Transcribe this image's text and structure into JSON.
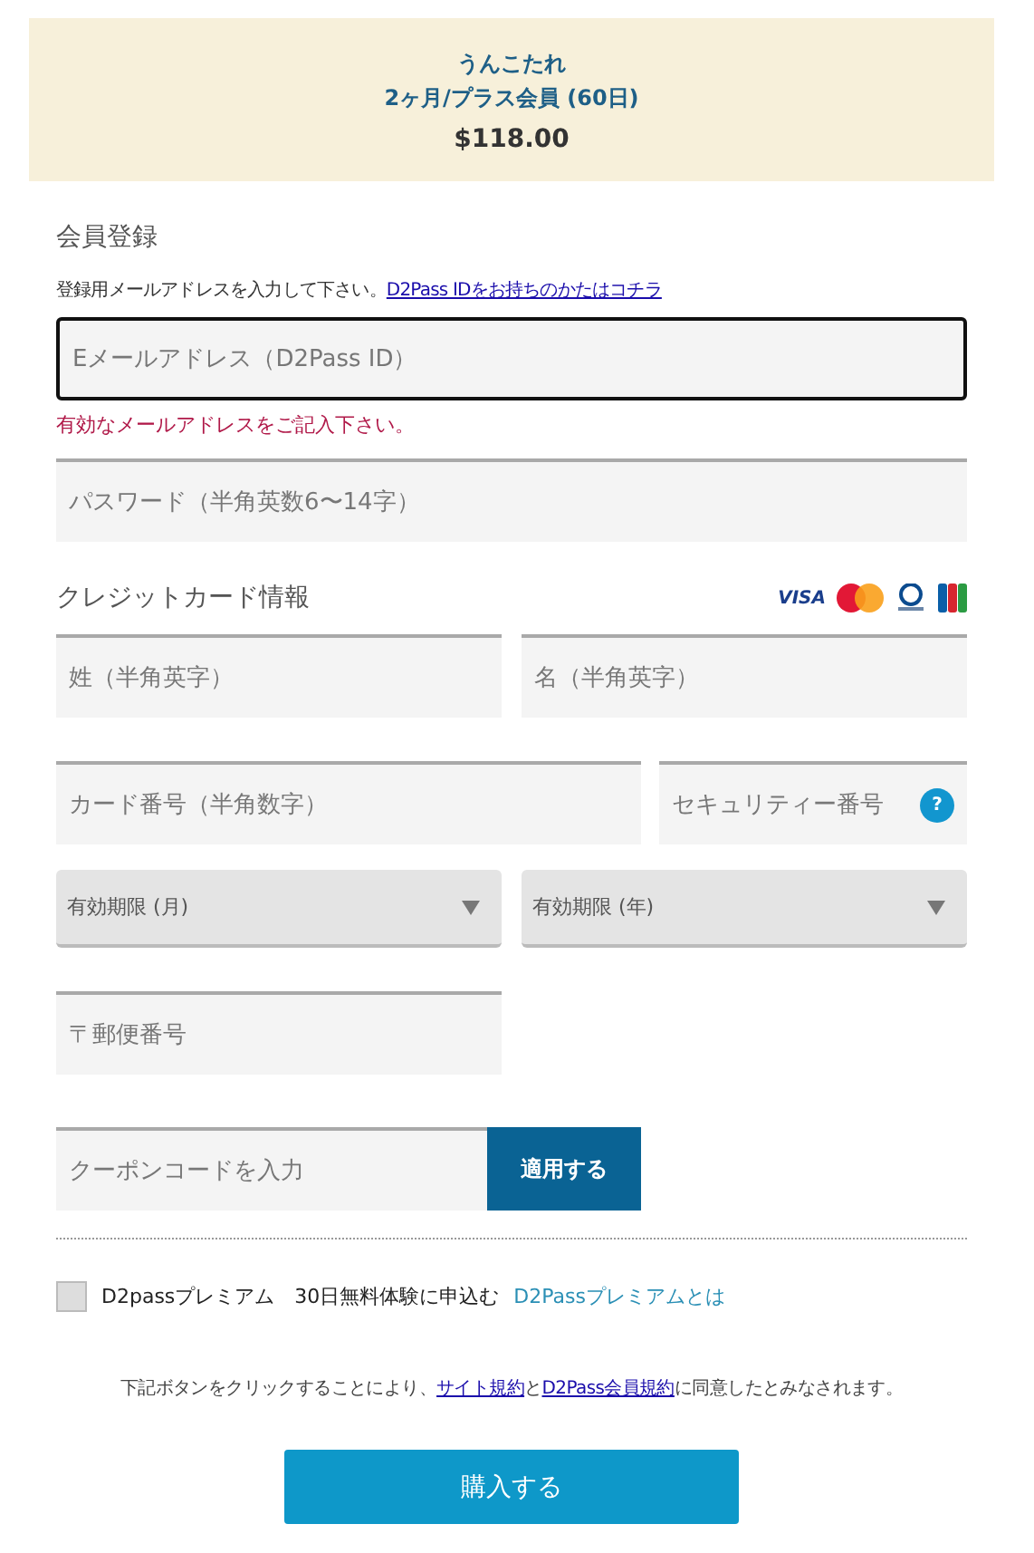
{
  "plan": {
    "name": "うんこたれ",
    "term": "2ヶ月/プラス会員 (60日)",
    "price": "$118.00"
  },
  "registration": {
    "title": "会員登録",
    "hint": "登録用メールアドレスを入力して下さい。",
    "hint_link": "D2Pass IDをお持ちのかたはコチラ",
    "email": {
      "placeholder": "Eメールアドレス（D2Pass ID）",
      "focused": true
    },
    "error": "有効なメールアドレスをご記入下さい。",
    "password": {
      "placeholder": "パスワード（半角英数6〜14字）"
    }
  },
  "card": {
    "title": "クレジットカード情報",
    "visa_logo": "VISA",
    "last_name": {
      "placeholder": "姓（半角英字）"
    },
    "first_name": {
      "placeholder": "名（半角英字）"
    },
    "number": {
      "placeholder": "カード番号（半角数字）"
    },
    "security": {
      "placeholder": "セキュリティー番号",
      "help": "?"
    },
    "expiry_month": {
      "label": "有効期限 (月)"
    },
    "expiry_year": {
      "label": "有効期限 (年)"
    },
    "postal": {
      "placeholder": "〒郵便番号"
    }
  },
  "coupon": {
    "placeholder": "クーポンコードを入力",
    "button": "適用する"
  },
  "premium": {
    "checked": false,
    "label": "D2passプレミアム　30日無料体験に申込む",
    "link": "D2Passプレミアムとは"
  },
  "terms": [
    {
      "text": "下記ボタンをクリックすることにより、",
      "link": false
    },
    {
      "text": "サイト規約",
      "link": true
    },
    {
      "text": "と",
      "link": false
    },
    {
      "text": "D2Pass会員規約",
      "link": true
    },
    {
      "text": "に同意したとみなされます。",
      "link": false
    }
  ],
  "purchase_button": "購入する"
}
